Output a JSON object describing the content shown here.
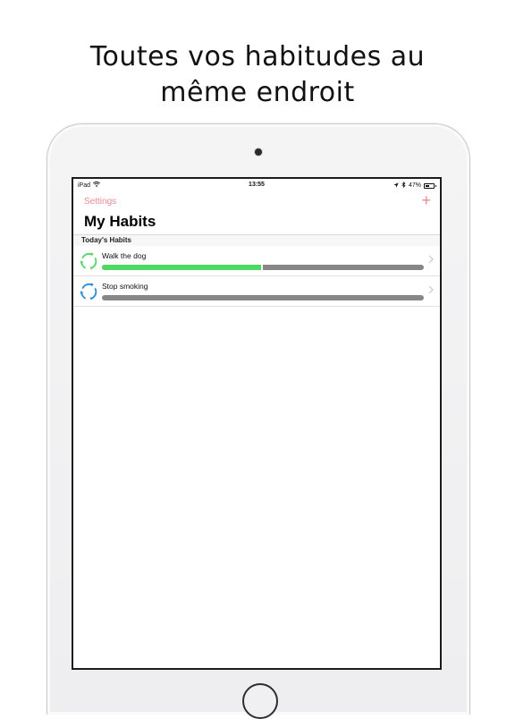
{
  "headline": {
    "line1": "Toutes vos habitudes au",
    "line2": "même endroit"
  },
  "status_bar": {
    "carrier": "iPad",
    "time": "13:55",
    "battery": "47%",
    "battery_level": 0.47,
    "icons": [
      "wifi-icon",
      "location-arrow-icon",
      "bluetooth-icon",
      "battery-icon"
    ]
  },
  "nav": {
    "settings_label": "Settings",
    "add_label": "+",
    "title": "My Habits",
    "accent_color": "#f08a8f"
  },
  "section": {
    "header": "Today's Habits"
  },
  "habits": [
    {
      "name": "Walk the dog",
      "progress": 0.5,
      "icon": "cycle-arrows-icon",
      "color": "#4cd964"
    },
    {
      "name": "Stop smoking",
      "progress": 0,
      "icon": "cycle-arrows-icon",
      "color": "#1e8ee8"
    }
  ],
  "colors": {
    "progress_track": "#878787",
    "progress_fill": "#4cd964",
    "chevron": "#c7c7cc"
  }
}
